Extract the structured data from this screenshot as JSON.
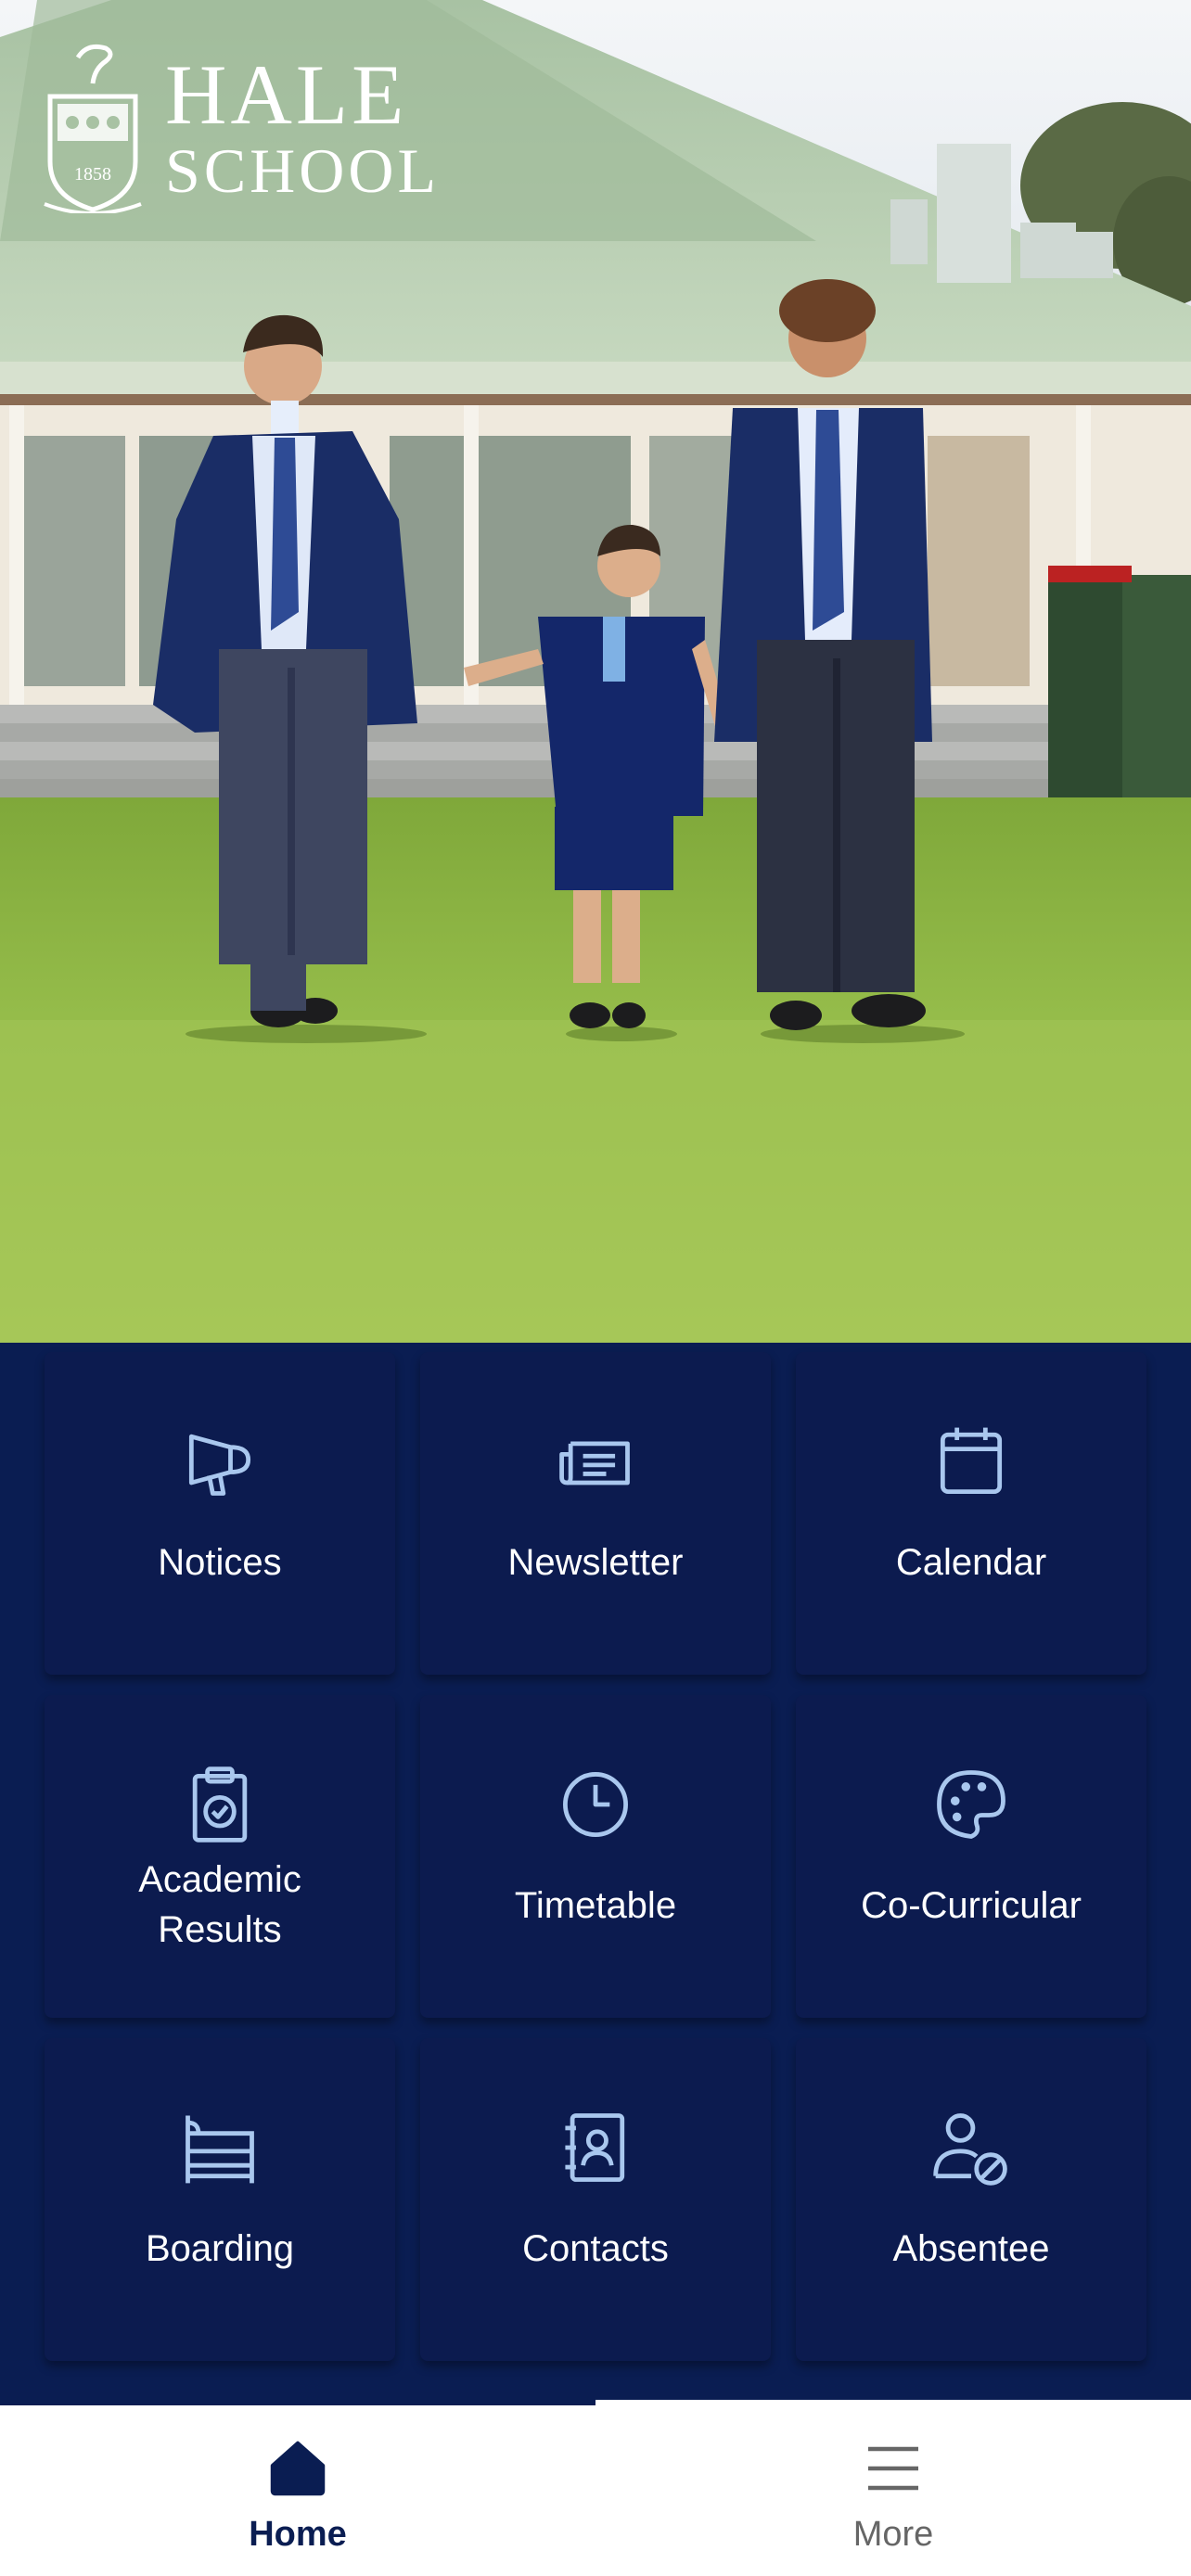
{
  "school": {
    "name_line1": "HALE",
    "name_line2": "SCHOOL",
    "crest_year": "1858"
  },
  "tiles": [
    {
      "label": "Notices",
      "icon": "megaphone-icon"
    },
    {
      "label": "Newsletter",
      "icon": "newspaper-icon"
    },
    {
      "label": "Calendar",
      "icon": "calendar-icon"
    },
    {
      "label": "Academic\nResults",
      "icon": "clipboard-check-icon"
    },
    {
      "label": "Timetable",
      "icon": "clock-icon"
    },
    {
      "label": "Co-Curricular",
      "icon": "palette-icon"
    },
    {
      "label": "Boarding",
      "icon": "bed-icon"
    },
    {
      "label": "Contacts",
      "icon": "contact-book-icon"
    },
    {
      "label": "Absentee",
      "icon": "user-absent-icon"
    }
  ],
  "nav": {
    "home_label": "Home",
    "more_label": "More",
    "active": "home"
  },
  "colors": {
    "navy": "#0a1d52",
    "tile": "#0c1b4f",
    "icon_light_blue": "#a9c7ee",
    "inactive_nav": "#666666"
  }
}
